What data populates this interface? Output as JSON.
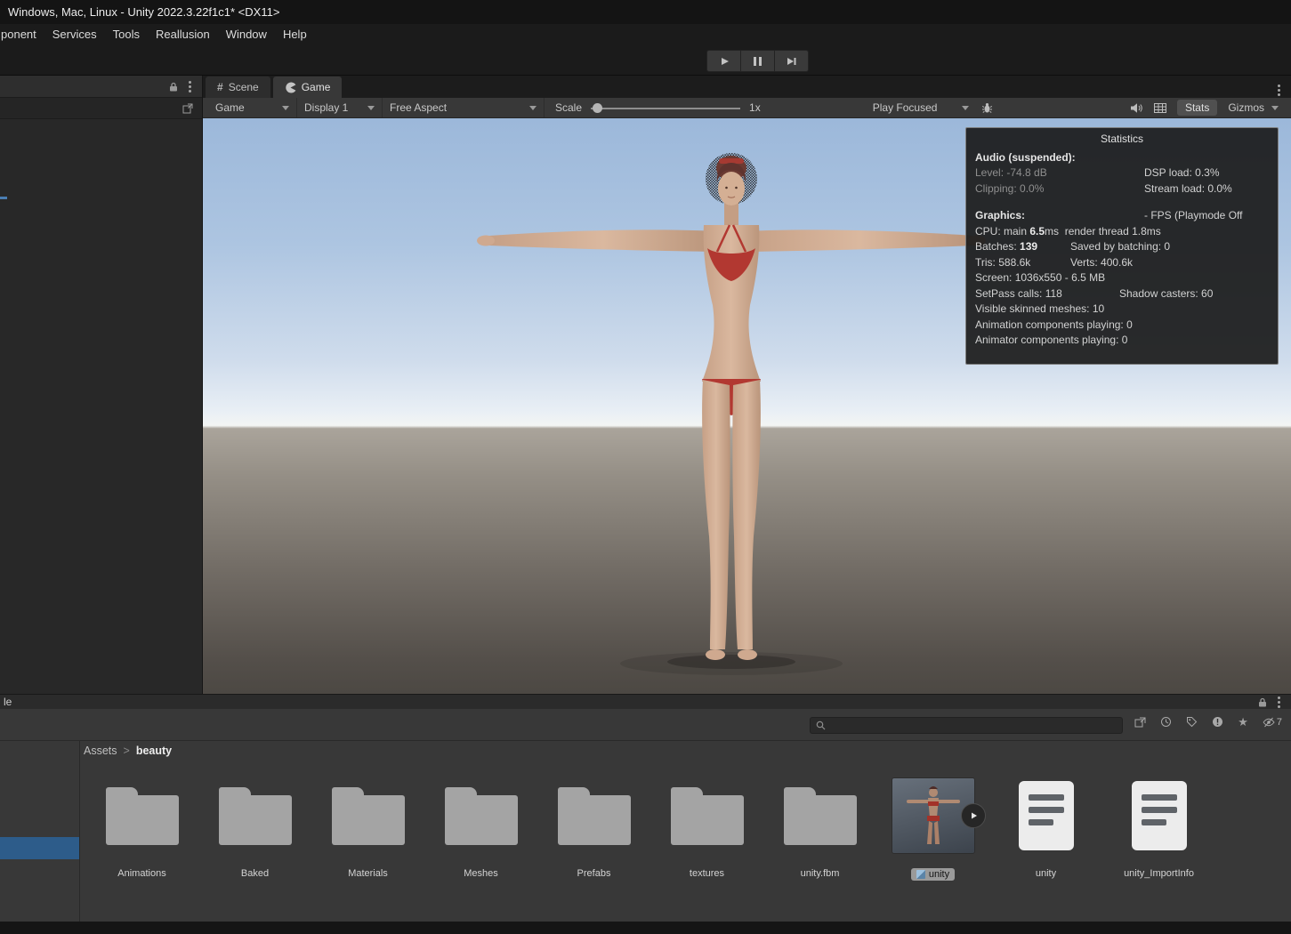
{
  "window": {
    "title": "Windows, Mac, Linux - Unity 2022.3.22f1c1* <DX11>"
  },
  "menubar": {
    "items": [
      "ponent",
      "Services",
      "Tools",
      "Reallusion",
      "Window",
      "Help"
    ]
  },
  "tabs": {
    "scene": "Scene",
    "game": "Game"
  },
  "icons": {
    "scene_hash": "#"
  },
  "game_toolbar": {
    "target": "Game",
    "display": "Display 1",
    "aspect": "Free Aspect",
    "scale_label": "Scale",
    "scale_value": "1x",
    "play_focused": "Play Focused",
    "stats_button": "Stats",
    "gizmos": "Gizmos"
  },
  "stats": {
    "title": "Statistics",
    "audio_header": "Audio (suspended):",
    "level": "Level: -74.8 dB",
    "dsp_load": "DSP load: 0.3%",
    "clipping": "Clipping: 0.0%",
    "stream_load": "Stream load: 0.0%",
    "graphics_header": "Graphics:",
    "fps": "- FPS (Playmode Off",
    "cpu_pre": "CPU: main ",
    "cpu_bold": "6.5",
    "cpu_post": "ms  render thread 1.8ms",
    "batches_pre": "Batches: ",
    "batches_bold": "139",
    "batches_right": "Saved by batching: 0",
    "tris": "Tris: 588.6k",
    "verts": "Verts: 400.6k",
    "screen": "Screen: 1036x550 - 6.5 MB",
    "setpass": "SetPass calls: 118",
    "shadow_casters": "Shadow casters: 60",
    "skinned": "Visible skinned meshes: 10",
    "anim_playing": "Animation components playing: 0",
    "animator_playing": "Animator components playing: 0"
  },
  "status_tab": "le",
  "project": {
    "breadcrumb_root": "Assets",
    "breadcrumb_sep": ">",
    "breadcrumb_current": "beauty",
    "hidden_count": "7",
    "items": [
      {
        "label": "Animations",
        "type": "folder"
      },
      {
        "label": "Baked",
        "type": "folder"
      },
      {
        "label": "Materials",
        "type": "folder"
      },
      {
        "label": "Meshes",
        "type": "folder"
      },
      {
        "label": "Prefabs",
        "type": "folder"
      },
      {
        "label": "textures",
        "type": "folder"
      },
      {
        "label": "unity.fbm",
        "type": "folder"
      },
      {
        "label": "unity",
        "type": "prefab"
      },
      {
        "label": "unity",
        "type": "file"
      },
      {
        "label": "unity_ImportInfo",
        "type": "file"
      }
    ]
  },
  "colors": {
    "selection_blue": "#2d5c8a",
    "bikini_red": "#b23831"
  }
}
